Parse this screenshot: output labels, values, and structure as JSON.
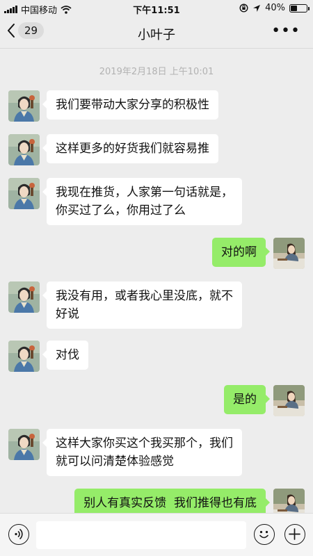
{
  "status_bar": {
    "carrier": "中国移动",
    "time": "下午11:51",
    "battery": "40%",
    "battery_level": 0.4
  },
  "nav": {
    "back_badge": "29",
    "title": "小叶子",
    "more_icon": "ellipsis-icon"
  },
  "chat": {
    "timestamp": "2019年2月18日 上午10:01",
    "messages": [
      {
        "from": "other",
        "text": "我们要带动大家分享的积极性"
      },
      {
        "from": "other",
        "text": "这样更多的好货我们就容易推"
      },
      {
        "from": "other",
        "lines": [
          "我现在推货，人家第一句话就是，",
          "你买过了么，你用过了么"
        ]
      },
      {
        "from": "me",
        "text": "对的啊"
      },
      {
        "from": "other",
        "lines": [
          "我没有用，或者我心里没底，就不",
          "好说"
        ]
      },
      {
        "from": "other",
        "text": "对伐"
      },
      {
        "from": "me",
        "text": "是的"
      },
      {
        "from": "other",
        "lines": [
          "这样大家你买这个我买那个，我们",
          "就可以问清楚体验感觉"
        ]
      },
      {
        "from": "me",
        "text": "别人有真实反馈  我们推得也有底"
      }
    ]
  },
  "input_bar": {
    "voice_icon": "voice-icon",
    "emoji_icon": "emoji-icon",
    "plus_icon": "plus-icon",
    "text_value": ""
  },
  "colors": {
    "background": "#ededed",
    "outgoing_bubble": "#95ec69",
    "incoming_bubble": "#ffffff",
    "timestamp": "#b2b2b2"
  }
}
